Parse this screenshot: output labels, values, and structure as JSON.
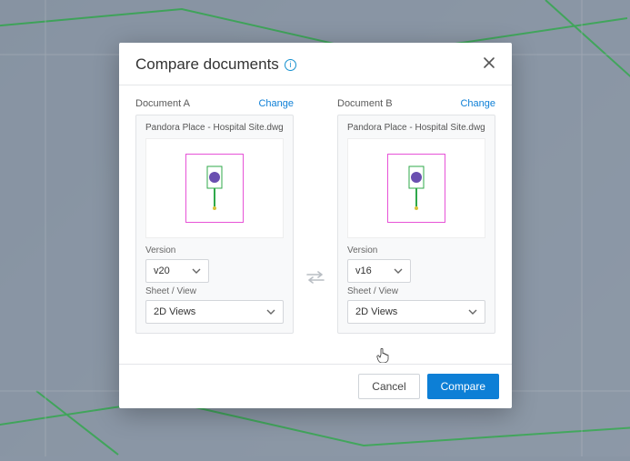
{
  "modal": {
    "title": "Compare documents",
    "cancel_label": "Cancel",
    "compare_label": "Compare"
  },
  "labels": {
    "change": "Change",
    "version": "Version",
    "sheet_view": "Sheet / View"
  },
  "docA": {
    "label": "Document A",
    "filename": "Pandora Place - Hospital Site.dwg",
    "version": "v20",
    "sheet_view": "2D Views"
  },
  "docB": {
    "label": "Document B",
    "filename": "Pandora Place - Hospital Site.dwg",
    "version": "v16",
    "sheet_view": "2D Views"
  }
}
